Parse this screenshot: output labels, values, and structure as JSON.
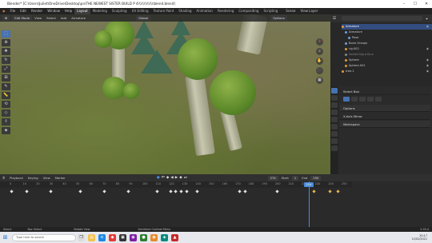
{
  "titlebar": {
    "title": "Blender* [C:\\Users\\Juliet\\OneDrive\\Desktop\\prsTHE NEWEST SISTER BUILD P 4\\\\\\\\\\\\\\\\\\\\\\\\\\\\blend.blend]",
    "minimize": "–",
    "maximize": "☐",
    "close": "✕"
  },
  "menubar": {
    "items": [
      "File",
      "Edit",
      "Render",
      "Window",
      "Help"
    ],
    "workspaces": [
      "Layout",
      "Modeling",
      "Sculpting",
      "UV Editing",
      "Texture Paint",
      "Shading",
      "Animation",
      "Rendering",
      "Compositing",
      "Scripting"
    ],
    "active_workspace": "Layout",
    "scene": "Scene",
    "view_layer": "View Layer"
  },
  "viewport": {
    "mode": "Edit Mode",
    "menus": [
      "View",
      "Select",
      "Add",
      "Armature"
    ],
    "transform": "Global",
    "options": "Options"
  },
  "outliner": {
    "items": [
      {
        "label": "Armature",
        "selected": true
      },
      {
        "label": "Armature",
        "selected": false
      },
      {
        "label": "Pose",
        "selected": false
      },
      {
        "label": "Bone Groups",
        "selected": false
      },
      {
        "label": "rig.002",
        "selected": false
      },
      {
        "label": "Socket big a.lib.e",
        "selected": false
      },
      {
        "label": "Sphere",
        "selected": false
      },
      {
        "label": "Sphere.001",
        "selected": false
      },
      {
        "label": "tree.1",
        "selected": false
      }
    ]
  },
  "properties": {
    "context": "Select Box",
    "sections": [
      "Options",
      "X-Axis Mirror",
      "Workspace"
    ]
  },
  "timeline": {
    "menus": [
      "Playback",
      "Keying",
      "View",
      "Marker"
    ],
    "current_frame": "274",
    "start": "1",
    "end": "250",
    "start_label": "Start",
    "end_label": "End",
    "ticks": [
      "0",
      "10",
      "20",
      "30",
      "40",
      "50",
      "60",
      "70",
      "80",
      "90",
      "100",
      "110",
      "120",
      "130",
      "140",
      "150",
      "160",
      "170",
      "180",
      "190",
      "200",
      "210",
      "220",
      "230",
      "240",
      "250"
    ],
    "playhead_frame": "224",
    "keyframes": [
      0,
      12,
      30,
      52,
      70,
      88,
      110,
      120,
      124,
      128,
      132,
      140,
      172,
      176,
      200,
      228,
      240,
      246
    ]
  },
  "statusbar": {
    "select": "Select",
    "box_select": "Box Select",
    "rotate": "Rotate View",
    "context_menu": "Armature Context Menu",
    "version": "2.93.4"
  },
  "taskbar": {
    "search_placeholder": "Type here to search",
    "time": "20:17",
    "date": "12/02/2021"
  }
}
